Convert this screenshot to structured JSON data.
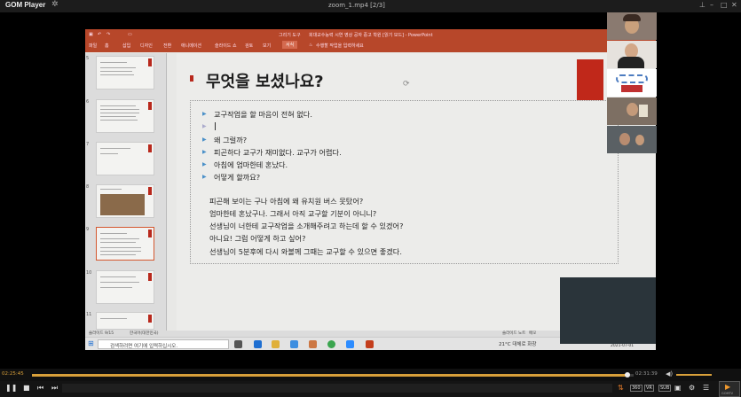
{
  "player": {
    "app_name": "GOM Player",
    "file_title": "zoom_1.mp4  [2/3]",
    "time_current": "02:25:45",
    "time_total": "02:31:39",
    "progress": 0.99,
    "badge_360": "360",
    "badge_vr": "VR",
    "subtitle_label": "SUB",
    "play_button_label": "GOMTV"
  },
  "ppt": {
    "window_title": "회대교수능력 시연 영상  공자 중고 학원 [읽기 모드] - PowerPoint",
    "title_mode": "그리기 도구",
    "ribbon_tabs": [
      "파일",
      "홈",
      "삽입",
      "디자인",
      "전환",
      "애니메이션",
      "슬라이드 쇼",
      "검토",
      "보기"
    ],
    "ribbon_extra": "서식",
    "ribbon_hint": "수행할 작업을 입력하세요",
    "status_left": "슬라이드 9/15",
    "status_lang": "한국어(대한민국)",
    "status_notes": "슬라이드 노트",
    "status_comments": "메모",
    "slide_numbers": [
      "5",
      "6",
      "7",
      "8",
      "9",
      "10",
      "11"
    ]
  },
  "slide": {
    "title": "무엇을 보셨나요?",
    "bullets": [
      "교구작업을 할 마음이 전혀 없다.",
      "",
      "왜 그럴까?",
      "피곤하다  교구가 재미없다.  교구가 어렵다.",
      "아침에 엄마한테 혼났다.",
      "어떻게 할까요?"
    ],
    "paragraph": [
      " 피곤해 보이는 구나   아침에 왜 유치원 버스 못탔어?",
      "엄마한테 혼났구나. 그래서 아직 교구할 기분이 아니니?",
      "선생님이 너한테 교구작업을 소개해주려고 하는데 할 수 있겠어?",
      "아니요!  그럼 어떻게 하고 싶어?",
      "선생님이 5분후에 다시 와볼께  그때는 교구할 수 있으면 좋겠다."
    ]
  },
  "taskbar": {
    "search_placeholder": "검색하려면 여기에 입력하십시오.",
    "weather": "21°C  대체로 화창",
    "clock": "2021-07-01"
  }
}
